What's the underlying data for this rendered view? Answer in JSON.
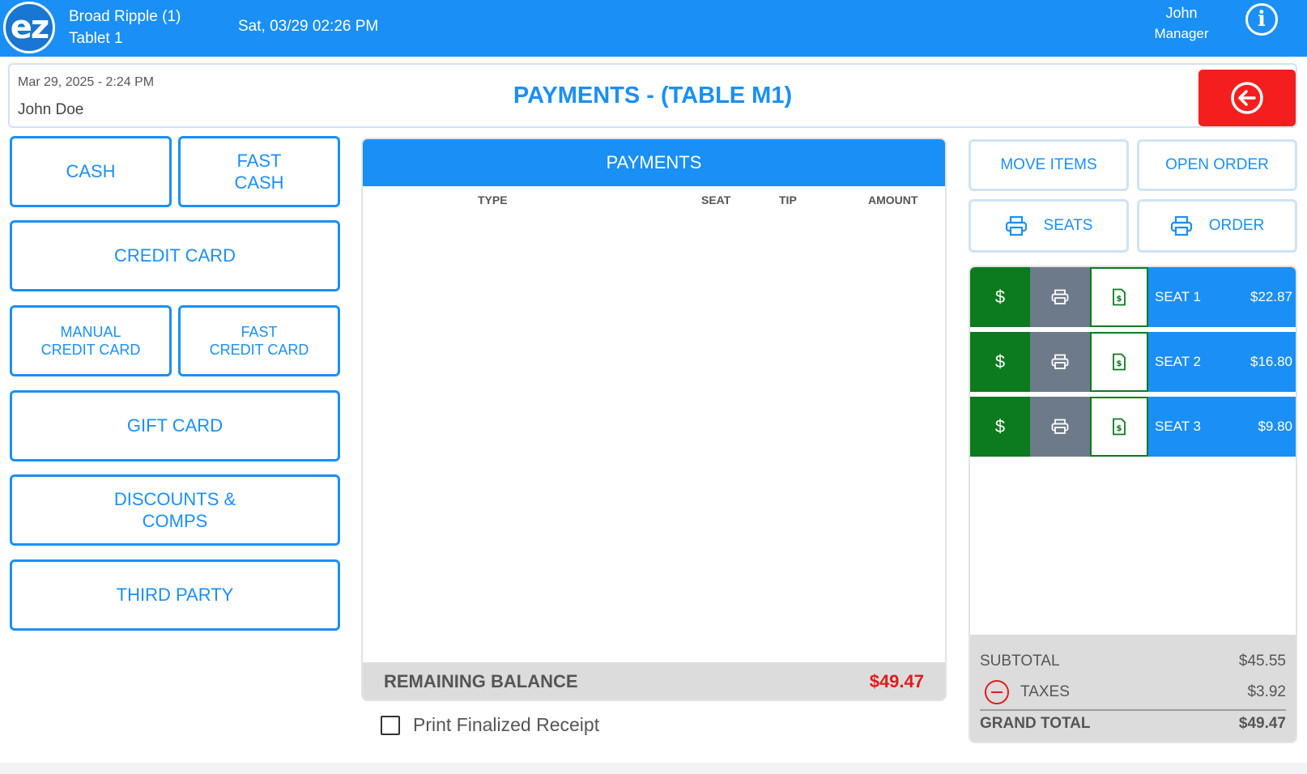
{
  "topbar": {
    "logo_text": "ez",
    "location": "Broad Ripple (1)",
    "device": "Tablet 1",
    "datetime": "Sat, 03/29 02:26 PM",
    "user_name": "John",
    "user_role": "Manager",
    "info_glyph": "i"
  },
  "header": {
    "order_date": "Mar 29, 2025  - 2:24 PM",
    "customer": "John Doe",
    "title": "PAYMENTS - (TABLE M1)"
  },
  "payment_methods": {
    "cash": "CASH",
    "fast_cash": "FAST\nCASH",
    "credit_card": "CREDIT CARD",
    "manual_credit_card": "MANUAL\nCREDIT CARD",
    "fast_credit_card": "FAST\nCREDIT CARD",
    "gift_card": "GIFT CARD",
    "discounts": "DISCOUNTS &\nCOMPS",
    "third_party": "THIRD PARTY"
  },
  "payments_table": {
    "title": "PAYMENTS",
    "columns": [
      "TYPE",
      "SEAT",
      "TIP",
      "AMOUNT"
    ],
    "rows": [],
    "remaining_label": "REMAINING BALANCE",
    "remaining_value": "$49.47",
    "print_receipt_label": "Print Finalized Receipt"
  },
  "actions": {
    "move_items": "MOVE ITEMS",
    "open_order": "OPEN ORDER",
    "print_seats": "SEATS",
    "print_order": "ORDER"
  },
  "seats": [
    {
      "name": "SEAT 1",
      "amount": "$22.87"
    },
    {
      "name": "SEAT 2",
      "amount": "$16.80"
    },
    {
      "name": "SEAT 3",
      "amount": "$9.80"
    }
  ],
  "seat_pay_glyph": "$",
  "totals": {
    "subtotal_label": "SUBTOTAL",
    "subtotal_value": "$45.55",
    "taxes_label": "TAXES",
    "taxes_value": "$3.92",
    "grand_total_label": "GRAND TOTAL",
    "grand_total_value": "$49.47"
  },
  "colors": {
    "primary_blue": "#1a8ff5",
    "back_red": "#f41e1e",
    "balance_red": "#e21b1b",
    "seat_green": "#0c7a1e",
    "seat_gray": "#6d7a89"
  },
  "icons": {
    "back": "arrow-left-circle-icon",
    "info": "info-icon",
    "printer": "printer-icon",
    "receipt": "receipt-icon",
    "remove_tax": "minus-circle-icon"
  }
}
